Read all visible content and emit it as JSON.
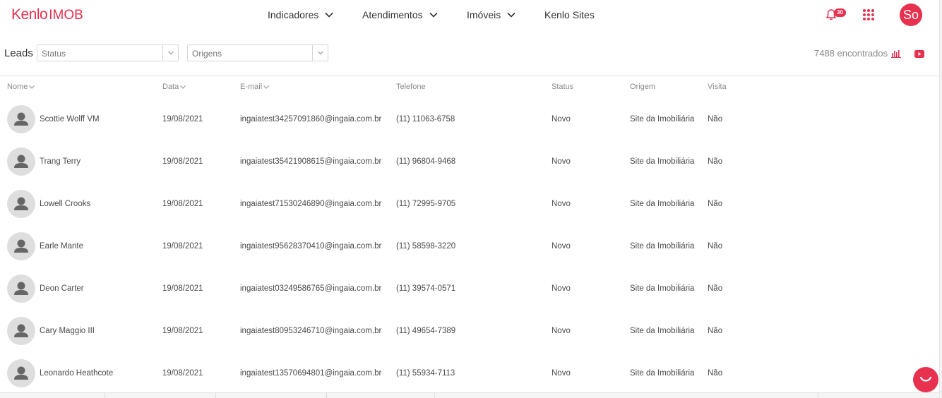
{
  "header": {
    "logo_brand": "Kenlo",
    "logo_product": "IMOB",
    "nav": [
      {
        "label": "Indicadores",
        "has_dropdown": true
      },
      {
        "label": "Atendimentos",
        "has_dropdown": true
      },
      {
        "label": "Imóveis",
        "has_dropdown": true
      },
      {
        "label": "Kenlo Sites",
        "has_dropdown": false
      }
    ],
    "notifications_count": "30",
    "user_initials": "So"
  },
  "filters": {
    "title": "Leads",
    "status_placeholder": "Status",
    "origens_placeholder": "Origens",
    "results_count": "7488 encontrados"
  },
  "table": {
    "columns": [
      {
        "key": "nome",
        "label": "Nome",
        "sortable": true
      },
      {
        "key": "data",
        "label": "Data",
        "sortable": true
      },
      {
        "key": "email",
        "label": "E-mail",
        "sortable": true
      },
      {
        "key": "telefone",
        "label": "Telefone",
        "sortable": false
      },
      {
        "key": "status",
        "label": "Status",
        "sortable": false
      },
      {
        "key": "origem",
        "label": "Origem",
        "sortable": false
      },
      {
        "key": "visita",
        "label": "Visita",
        "sortable": false
      }
    ],
    "rows": [
      {
        "nome": "Scottie Wolff VM",
        "data": "19/08/2021",
        "email": "ingaiatest34257091860@ingaia.com.br",
        "telefone": "(11) 11063-6758",
        "status": "Novo",
        "origem": "Site da Imobiliária",
        "visita": "Não"
      },
      {
        "nome": "Trang Terry",
        "data": "19/08/2021",
        "email": "ingaiatest35421908615@ingaia.com.br",
        "telefone": "(11) 96804-9468",
        "status": "Novo",
        "origem": "Site da Imobiliária",
        "visita": "Não"
      },
      {
        "nome": "Lowell Crooks",
        "data": "19/08/2021",
        "email": "ingaiatest71530246890@ingaia.com.br",
        "telefone": "(11) 72995-9705",
        "status": "Novo",
        "origem": "Site da Imobiliária",
        "visita": "Não"
      },
      {
        "nome": "Earle Mante",
        "data": "19/08/2021",
        "email": "ingaiatest95628370410@ingaia.com.br",
        "telefone": "(11) 58598-3220",
        "status": "Novo",
        "origem": "Site da Imobiliária",
        "visita": "Não"
      },
      {
        "nome": "Deon Carter",
        "data": "19/08/2021",
        "email": "ingaiatest03249586765@ingaia.com.br",
        "telefone": "(11) 39574-0571",
        "status": "Novo",
        "origem": "Site da Imobiliária",
        "visita": "Não"
      },
      {
        "nome": "Cary Maggio III",
        "data": "19/08/2021",
        "email": "ingaiatest80953246710@ingaia.com.br",
        "telefone": "(11) 49654-7389",
        "status": "Novo",
        "origem": "Site da Imobiliária",
        "visita": "Não"
      },
      {
        "nome": "Leonardo Heathcote",
        "data": "19/08/2021",
        "email": "ingaiatest13570694801@ingaia.com.br",
        "telefone": "(11) 55934-7113",
        "status": "Novo",
        "origem": "Site da Imobiliária",
        "visita": "Não"
      }
    ]
  },
  "colors": {
    "accent": "#e8304f",
    "text": "#4a4a4a",
    "muted": "#8a8a8a"
  }
}
